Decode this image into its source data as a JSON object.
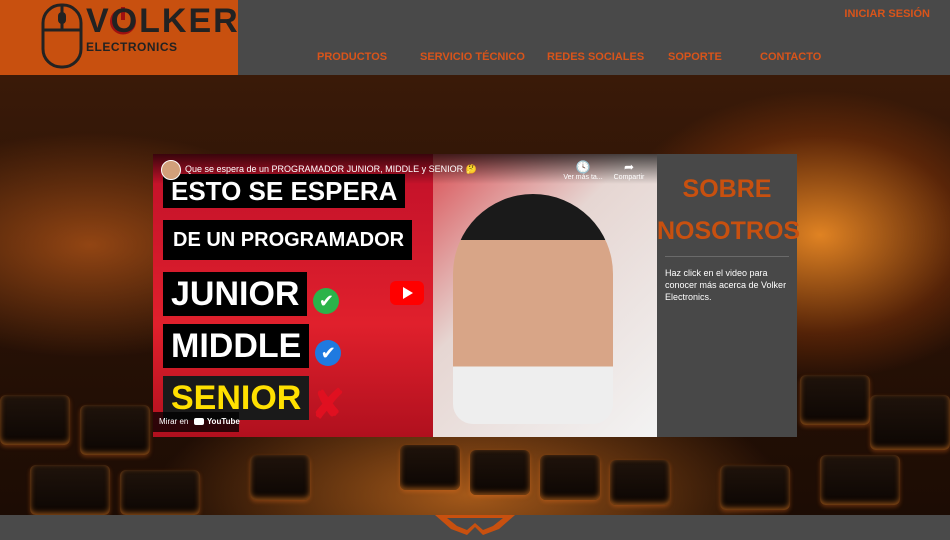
{
  "header": {
    "logo": {
      "title": "VOLKER",
      "subtitle": "ELECTRONICS"
    },
    "login_label": "INICIAR SESIÓN",
    "nav": [
      "PRODUCTOS",
      "SERVICIO TÉCNICO",
      "REDES SOCIALES",
      "SOPORTE",
      "CONTACTO"
    ]
  },
  "video": {
    "title": "Que se espera de un PROGRAMADOR JUNIOR, MIDDLE y SENIOR 🤔",
    "watch_later": "Ver más ta...",
    "share": "Compartir",
    "watch_on": "Mirar en",
    "youtube": "YouTube",
    "thumb_lines": [
      "ESTO SE ESPERA",
      "DE UN PROGRAMADOR",
      "JUNIOR",
      "MIDDLE",
      "SENIOR"
    ],
    "thumb_marks": [
      "✔",
      "✔",
      "✘"
    ],
    "play_icon": "youtube-play-icon"
  },
  "about": {
    "title_line1": "SOBRE",
    "title_line2": "NOSOTROS",
    "text": "Haz click en el video para conocer más acerca de Volker Electronics."
  },
  "colors": {
    "accent": "#c8500f",
    "header_bg": "#494949",
    "panel_bg": "#484848"
  }
}
